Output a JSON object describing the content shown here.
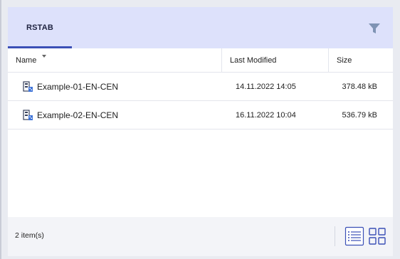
{
  "tabs": [
    {
      "label": "RSTAB",
      "active": true
    }
  ],
  "columns": {
    "name": "Name",
    "modified": "Last Modified",
    "size": "Size"
  },
  "files": [
    {
      "name": "Example-01-EN-CEN",
      "modified": "14.11.2022 14:05",
      "size": "378.48 kB",
      "icon": "rstab-model-icon"
    },
    {
      "name": "Example-02-EN-CEN",
      "modified": "16.11.2022 10:04",
      "size": "536.79 kB",
      "icon": "rstab-model-icon"
    }
  ],
  "footer": {
    "count": "2 item(s)"
  },
  "colors": {
    "accent": "#3b4fb6",
    "tabbar": "#dde1fb",
    "filter_icon": "#7f93b4"
  }
}
